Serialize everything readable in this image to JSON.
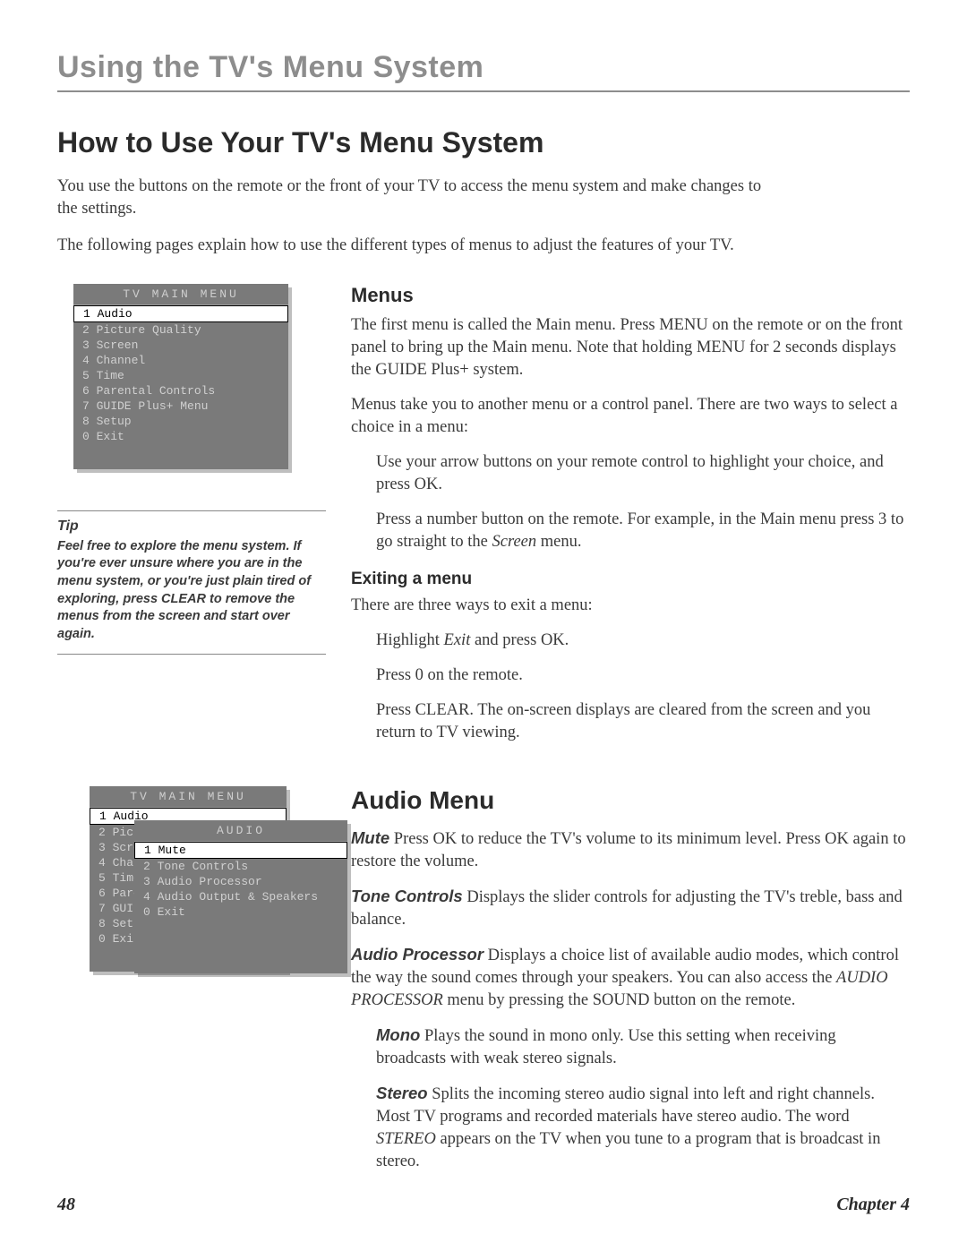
{
  "chapterTitle": "Using the TV's Menu System",
  "pageHeading": "How to Use Your TV's Menu System",
  "intro": {
    "p1": "You use the buttons on the remote or the front of your TV to access the menu system and make changes to the settings.",
    "p2": "The following pages explain how to use the different types of menus to adjust the features of your TV."
  },
  "mainMenuScreenshot": {
    "title": "TV MAIN MENU",
    "items": [
      {
        "num": "1",
        "label": "Audio",
        "selected": true
      },
      {
        "num": "2",
        "label": "Picture Quality",
        "selected": false
      },
      {
        "num": "3",
        "label": "Screen",
        "selected": false
      },
      {
        "num": "4",
        "label": "Channel",
        "selected": false
      },
      {
        "num": "5",
        "label": "Time",
        "selected": false
      },
      {
        "num": "6",
        "label": "Parental Controls",
        "selected": false
      },
      {
        "num": "7",
        "label": "GUIDE Plus+ Menu",
        "selected": false
      },
      {
        "num": "8",
        "label": "Setup",
        "selected": false
      },
      {
        "num": "0",
        "label": "Exit",
        "selected": false
      }
    ]
  },
  "tip": {
    "title": "Tip",
    "body": "Feel free to explore the menu system. If you're ever unsure where you are in the menu system, or you're just plain tired of exploring, press CLEAR to remove the menus from the screen and start over again."
  },
  "menusSection": {
    "heading": "Menus",
    "p1": "The first menu is called the Main menu. Press MENU on the remote or on the front panel to bring up the Main menu. Note that holding MENU for 2 seconds displays the GUIDE Plus+ system.",
    "p2": "Menus take you to another menu or a control panel. There are two ways to select a choice in a menu:",
    "bullet1": "Use your arrow buttons on your remote control to highlight your choice, and press OK.",
    "bullet2a": "Press a number button on the remote. For example, in the Main menu press 3 to go straight to the ",
    "bullet2b": "Screen",
    "bullet2c": " menu.",
    "exitHeading": "Exiting a menu",
    "exitIntro": "There are three ways to exit a menu:",
    "exit1a": "Highlight ",
    "exit1b": "Exit",
    "exit1c": " and press OK.",
    "exit2": "Press 0 on the remote.",
    "exit3": "Press CLEAR. The on-screen displays are cleared from the screen and you return to TV viewing."
  },
  "audioMenuScreenshot": {
    "backTitle": "TV MAIN MENU",
    "backItems": [
      {
        "num": "1",
        "label": "Audio",
        "selected": true
      },
      {
        "num": "2",
        "label": "Pict",
        "selected": false
      },
      {
        "num": "3",
        "label": "Scre",
        "selected": false
      },
      {
        "num": "4",
        "label": "Chan",
        "selected": false
      },
      {
        "num": "5",
        "label": "Time",
        "selected": false
      },
      {
        "num": "6",
        "label": "Pare",
        "selected": false
      },
      {
        "num": "7",
        "label": "GUID",
        "selected": false
      },
      {
        "num": "8",
        "label": "Setu",
        "selected": false
      },
      {
        "num": "0",
        "label": "Exit",
        "selected": false
      }
    ],
    "frontTitle": "AUDIO",
    "frontItems": [
      {
        "num": "1",
        "label": "Mute",
        "selected": true
      },
      {
        "num": "2",
        "label": "Tone Controls",
        "selected": false
      },
      {
        "num": "3",
        "label": "Audio Processor",
        "selected": false
      },
      {
        "num": "4",
        "label": "Audio Output & Speakers",
        "selected": false
      },
      {
        "num": "0",
        "label": "Exit",
        "selected": false
      }
    ]
  },
  "audioSection": {
    "heading": "Audio Menu",
    "muteLabel": "Mute",
    "muteText": "  Press OK to reduce the TV's volume to its minimum level. Press OK again to restore the volume.",
    "toneLabel": "Tone Controls",
    "toneText": "  Displays the slider controls for adjusting the TV's treble, bass and balance.",
    "procLabel": "Audio Processor",
    "procText1": "  Displays a choice list of available audio modes, which control the way the sound comes through your speakers. You can also access the ",
    "procText2": "AUDIO PROCESSOR",
    "procText3": " menu by pressing the SOUND button on the remote.",
    "monoLabel": "Mono",
    "monoText": "   Plays the sound in mono only. Use this setting when receiving broadcasts with weak stereo signals.",
    "stereoLabel": "Stereo",
    "stereoText1": "   Splits the incoming stereo audio signal into left and right channels. Most TV programs and recorded materials have stereo audio. The word ",
    "stereoText2": "STEREO",
    "stereoText3": " appears on the TV when you tune to a program that is broadcast in stereo."
  },
  "footer": {
    "pageNum": "48",
    "chapter": "Chapter 4"
  }
}
